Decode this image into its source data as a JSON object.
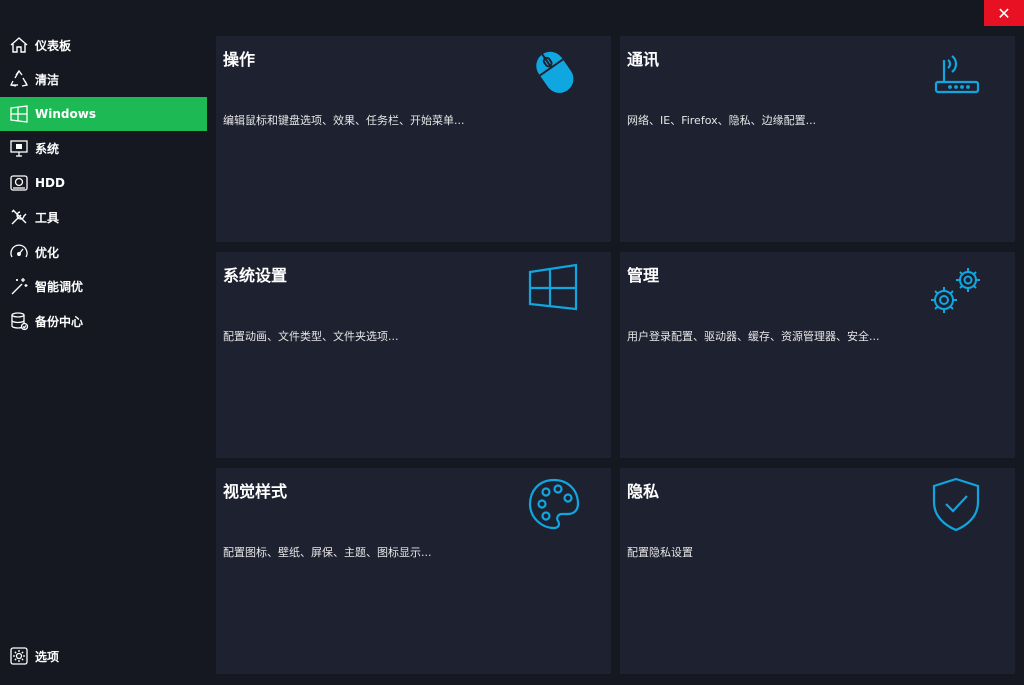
{
  "window": {
    "close_glyph": "✕"
  },
  "sidebar": {
    "items": [
      {
        "label": "仪表板",
        "icon": "home-icon"
      },
      {
        "label": "清洁",
        "icon": "recycle-icon"
      },
      {
        "label": "Windows",
        "icon": "windows-logo-icon",
        "active": true
      },
      {
        "label": "系统",
        "icon": "monitor-icon"
      },
      {
        "label": "HDD",
        "icon": "hard-drive-icon"
      },
      {
        "label": "工具",
        "icon": "tools-icon"
      },
      {
        "label": "优化",
        "icon": "speedometer-icon"
      },
      {
        "label": "智能调优",
        "icon": "magic-wand-icon"
      },
      {
        "label": "备份中心",
        "icon": "database-icon"
      }
    ],
    "options": {
      "label": "选项",
      "icon": "settings-icon"
    }
  },
  "cards": [
    {
      "title": "操作",
      "desc": "编辑鼠标和键盘选项、效果、任务栏、开始菜单...",
      "icon": "mouse-icon"
    },
    {
      "title": "通讯",
      "desc": "网络、IE、Firefox、隐私、边缘配置...",
      "icon": "router-icon"
    },
    {
      "title": "系统设置",
      "desc": "配置动画、文件类型、文件夹选项...",
      "icon": "windows-logo-icon"
    },
    {
      "title": "管理",
      "desc": "用户登录配置、驱动器、缓存、资源管理器、安全...",
      "icon": "gears-icon"
    },
    {
      "title": "视觉样式",
      "desc": "配置图标、壁纸、屏保、主题、图标显示...",
      "icon": "palette-icon"
    },
    {
      "title": "隐私",
      "desc": "配置隐私设置",
      "icon": "shield-check-icon"
    }
  ],
  "colors": {
    "background": "#161821",
    "card": "#1e2130",
    "accent_active": "#1db954",
    "icon_blue": "#10a6e0",
    "close_red": "#e81123"
  }
}
